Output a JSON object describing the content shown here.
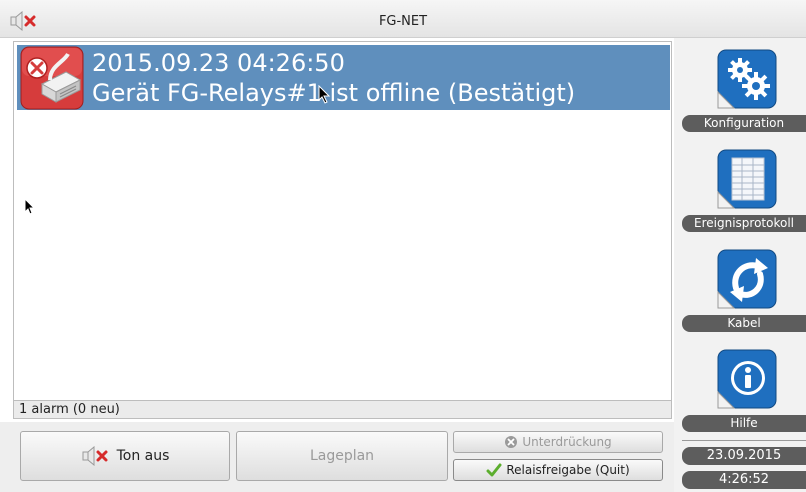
{
  "window": {
    "title": "FG-NET"
  },
  "alarms": [
    {
      "timestamp": "2015.09.23 04:26:50",
      "message": "Gerät FG-Relays#1 ist offline (Bestätigt)",
      "icon": "relay-offline-icon",
      "row_color": "#5f8fbd"
    }
  ],
  "status": {
    "count_text": "1 alarm (0 neu)"
  },
  "buttons": {
    "mute": "Ton aus",
    "map": "Lageplan",
    "suppress": "Unterdrückung",
    "relay_release": "Relaisfreigabe (Quit)"
  },
  "sidebar": {
    "items": [
      {
        "label": "Konfiguration",
        "icon": "gears-icon"
      },
      {
        "label": "Ereignisprotokoll",
        "icon": "event-log-icon"
      },
      {
        "label": "Kabel",
        "icon": "cable-icon"
      },
      {
        "label": "Hilfe",
        "icon": "info-icon"
      }
    ],
    "date": "23.09.2015",
    "time": "4:26:52"
  },
  "colors": {
    "accent": "#5f8fbd",
    "icon_blue": "#1f6fbf",
    "alarm_red": "#d63c3c",
    "label_bg": "#5d5d5d"
  }
}
